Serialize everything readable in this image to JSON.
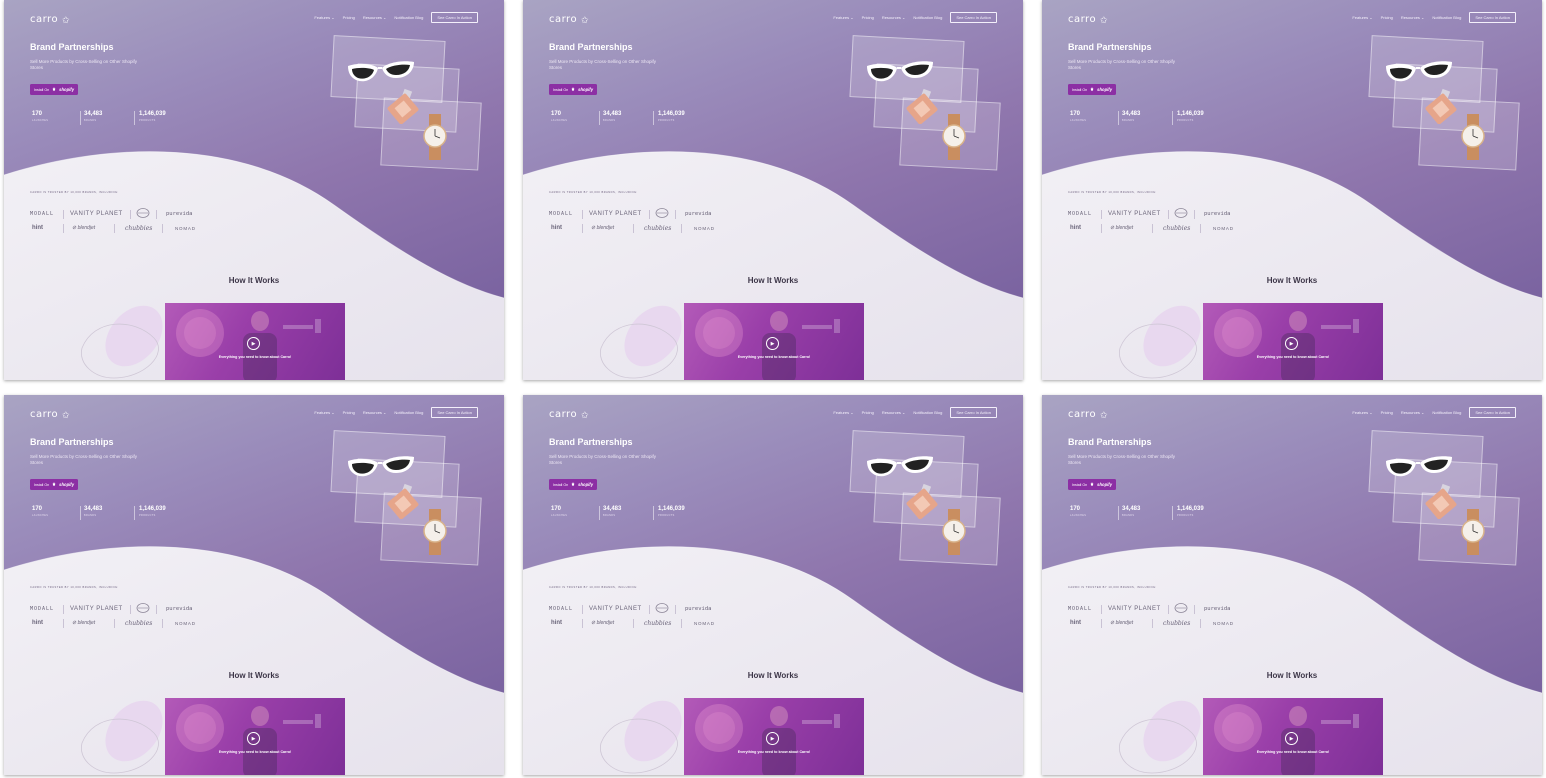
{
  "nav": {
    "logo": "carro",
    "links": [
      {
        "label": "Features ⌄"
      },
      {
        "label": "Pricing"
      },
      {
        "label": "Resources ⌄"
      },
      {
        "label": "Notification Blog"
      }
    ],
    "cta": "See Carro In Action"
  },
  "hero": {
    "title": "Brand Partnerships",
    "subtitle": "Sell More Products by Cross-Selling on Other Shopify Stores",
    "install_label": "Install On",
    "shopify_label": "shopify",
    "stats": [
      {
        "value": "170",
        "label": "LAUNCHES"
      },
      {
        "value": "34,483",
        "label": "BRANDS"
      },
      {
        "value": "1,146,039",
        "label": "PRODUCTS"
      }
    ]
  },
  "trusted": {
    "heading": "CARRO IS TRUSTED BY 10,000 BRANDS, INCLUDING:",
    "brands": [
      "MODALL",
      "VANITY PLANET",
      "purevida",
      "hint",
      "blendjet",
      "chubbies",
      "NOMAD"
    ]
  },
  "how_it_works": {
    "title": "How It Works",
    "video_caption": "Everything you need to know about Carro!"
  },
  "colors": {
    "accent": "#8c2fa4",
    "hero_top": "#a9a4c3",
    "hero_bottom": "#7a63a0"
  },
  "icons": {
    "logo": "star-icon",
    "play": "play-icon",
    "shopify": "shopify-bag-icon"
  }
}
